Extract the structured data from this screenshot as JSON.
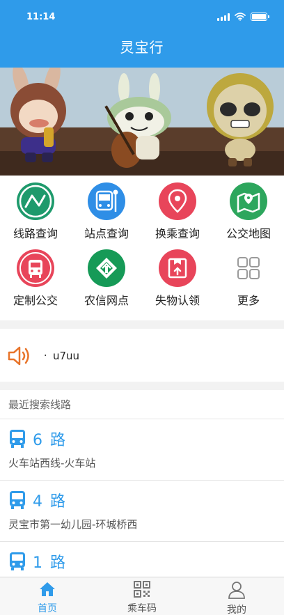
{
  "status_bar": {
    "time": "11:14"
  },
  "header": {
    "title": "灵宝行"
  },
  "banner": {
    "image": "three-toy-figures-banner"
  },
  "grid": {
    "items": [
      {
        "label": "线路查询",
        "icon": "route-search-icon",
        "color": "#1e9a6c"
      },
      {
        "label": "站点查询",
        "icon": "bus-stop-icon",
        "color": "#2f8ee6"
      },
      {
        "label": "换乘查询",
        "icon": "location-pin-icon",
        "color": "#e8455a"
      },
      {
        "label": "公交地图",
        "icon": "map-pin-icon",
        "color": "#2da65d"
      },
      {
        "label": "定制公交",
        "icon": "custom-bus-icon",
        "color": "#e8455a"
      },
      {
        "label": "农信网点",
        "icon": "bank-logo-icon",
        "color": "#169a57"
      },
      {
        "label": "失物认领",
        "icon": "lost-found-icon",
        "color": "#e8455a"
      },
      {
        "label": "更多",
        "icon": "more-grid-icon",
        "color": "#9a9a9a"
      }
    ]
  },
  "notice": {
    "dot": "·",
    "text": "u7uu",
    "icon": "speaker-icon",
    "color": "#e8742a"
  },
  "recent": {
    "heading": "最近搜索线路",
    "routes": [
      {
        "name": "6 路",
        "desc": "火车站西线-火车站"
      },
      {
        "name": "4 路",
        "desc": "灵宝市第一幼儿园-环城桥西"
      },
      {
        "name": "1 路",
        "desc": ""
      }
    ]
  },
  "tabbar": {
    "tabs": [
      {
        "label": "首页",
        "icon": "home-icon",
        "active": true
      },
      {
        "label": "乘车码",
        "icon": "qr-code-icon",
        "active": false
      },
      {
        "label": "我的",
        "icon": "user-icon",
        "active": false
      }
    ]
  },
  "colors": {
    "brand": "#2f9bea",
    "background": "#f2f2f2"
  }
}
